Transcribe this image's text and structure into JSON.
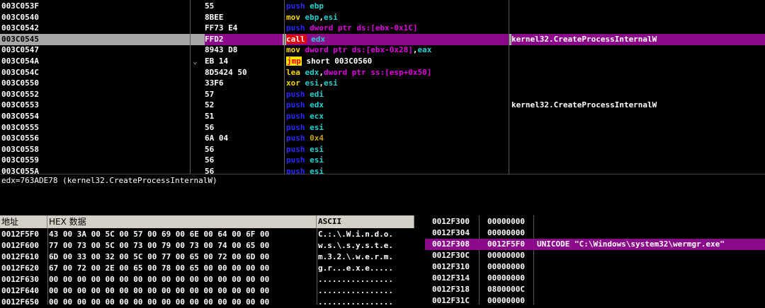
{
  "disasm": {
    "rows": [
      {
        "addr": "003C053F",
        "hex": "55",
        "mn": "push",
        "ops": [
          [
            "reg",
            "ebp"
          ]
        ],
        "cmt": "",
        "jmark": ""
      },
      {
        "addr": "003C0540",
        "hex": "8BEE",
        "mn": "mov",
        "ops": [
          [
            "reg",
            "ebp"
          ],
          [
            "lbl",
            ","
          ],
          [
            "reg",
            "esi"
          ]
        ],
        "cmt": "",
        "jmark": ""
      },
      {
        "addr": "003C0542",
        "hex": "FF73 E4",
        "mn": "push",
        "ops": [
          [
            "mem",
            "dword ptr ds:[ebx-0x1C]"
          ]
        ],
        "cmt": "",
        "jmark": ""
      },
      {
        "addr": "003C0545",
        "hex": "FFD2",
        "mn": "call",
        "ops": [
          [
            "reg",
            "edx"
          ]
        ],
        "cmt": "kernel32.CreateProcessInternalW",
        "jmark": "",
        "selected": true
      },
      {
        "addr": "003C0547",
        "hex": "8943 D8",
        "mn": "mov",
        "ops": [
          [
            "mem",
            "dword ptr ds:[ebx-0x28]"
          ],
          [
            "lbl",
            ","
          ],
          [
            "reg",
            "eax"
          ]
        ],
        "cmt": "",
        "jmark": ""
      },
      {
        "addr": "003C054A",
        "hex": "EB 14",
        "mn": "jmp",
        "ops": [
          [
            "lbl",
            "short 003C0560"
          ]
        ],
        "cmt": "",
        "jmark": "⌄"
      },
      {
        "addr": "003C054C",
        "hex": "8D5424 50",
        "mn": "lea",
        "ops": [
          [
            "reg",
            "edx"
          ],
          [
            "lbl",
            ","
          ],
          [
            "mem",
            "dword ptr ss:[esp+0x50]"
          ]
        ],
        "cmt": "",
        "jmark": ""
      },
      {
        "addr": "003C0550",
        "hex": "33F6",
        "mn": "xor",
        "ops": [
          [
            "reg",
            "esi"
          ],
          [
            "lbl",
            ","
          ],
          [
            "reg",
            "esi"
          ]
        ],
        "cmt": "",
        "jmark": ""
      },
      {
        "addr": "003C0552",
        "hex": "57",
        "mn": "push",
        "ops": [
          [
            "reg",
            "edi"
          ]
        ],
        "cmt": "",
        "jmark": ""
      },
      {
        "addr": "003C0553",
        "hex": "52",
        "mn": "push",
        "ops": [
          [
            "reg",
            "edx"
          ]
        ],
        "cmt": "kernel32.CreateProcessInternalW",
        "jmark": ""
      },
      {
        "addr": "003C0554",
        "hex": "51",
        "mn": "push",
        "ops": [
          [
            "reg",
            "ecx"
          ]
        ],
        "cmt": "",
        "jmark": ""
      },
      {
        "addr": "003C0555",
        "hex": "56",
        "mn": "push",
        "ops": [
          [
            "reg",
            "esi"
          ]
        ],
        "cmt": "",
        "jmark": ""
      },
      {
        "addr": "003C0556",
        "hex": "6A 04",
        "mn": "push",
        "ops": [
          [
            "imm",
            "0x4"
          ]
        ],
        "cmt": "",
        "jmark": ""
      },
      {
        "addr": "003C0558",
        "hex": "56",
        "mn": "push",
        "ops": [
          [
            "reg",
            "esi"
          ]
        ],
        "cmt": "",
        "jmark": ""
      },
      {
        "addr": "003C0559",
        "hex": "56",
        "mn": "push",
        "ops": [
          [
            "reg",
            "esi"
          ]
        ],
        "cmt": "",
        "jmark": ""
      },
      {
        "addr": "003C055A",
        "hex": "56",
        "mn": "push",
        "ops": [
          [
            "reg",
            "esi"
          ]
        ],
        "cmt": "",
        "jmark": ""
      }
    ]
  },
  "info": {
    "text": "edx=763ADE78 (kernel32.CreateProcessInternalW)"
  },
  "dump": {
    "header_addr": "地址",
    "header_hex": "HEX 数据",
    "header_ascii": "ASCII",
    "rows": [
      {
        "addr": "0012F5F0",
        "hex": "43 00 3A 00 5C 00 57 00 69 00 6E 00 64 00 6F 00",
        "ascii": "C.:.\\.W.i.n.d.o."
      },
      {
        "addr": "0012F600",
        "hex": "77 00 73 00 5C 00 73 00 79 00 73 00 74 00 65 00",
        "ascii": "w.s.\\.s.y.s.t.e."
      },
      {
        "addr": "0012F610",
        "hex": "6D 00 33 00 32 00 5C 00 77 00 65 00 72 00 6D 00",
        "ascii": "m.3.2.\\.w.e.r.m."
      },
      {
        "addr": "0012F620",
        "hex": "67 00 72 00 2E 00 65 00 78 00 65 00 00 00 00 00",
        "ascii": "g.r...e.x.e....."
      },
      {
        "addr": "0012F630",
        "hex": "00 00 00 00 00 00 00 00 00 00 00 00 00 00 00 00",
        "ascii": "................"
      },
      {
        "addr": "0012F640",
        "hex": "00 00 00 00 00 00 00 00 00 00 00 00 00 00 00 00",
        "ascii": "................"
      },
      {
        "addr": "0012F650",
        "hex": "00 00 00 00 00 00 00 00 00 00 00 00 00 00 00 00",
        "ascii": "................"
      }
    ]
  },
  "stack": {
    "rows": [
      {
        "addr": "0012F300",
        "val": "00000000",
        "cmt": ""
      },
      {
        "addr": "0012F304",
        "val": "00000000",
        "cmt": ""
      },
      {
        "addr": "0012F308",
        "val": "0012F5F0",
        "cmt": "UNICODE \"C:\\Windows\\system32\\wermgr.exe\"",
        "selected": true
      },
      {
        "addr": "0012F30C",
        "val": "00000000",
        "cmt": ""
      },
      {
        "addr": "0012F310",
        "val": "00000000",
        "cmt": ""
      },
      {
        "addr": "0012F314",
        "val": "00000000",
        "cmt": ""
      },
      {
        "addr": "0012F318",
        "val": "0800000C",
        "cmt": ""
      },
      {
        "addr": "0012F31C",
        "val": "00000000",
        "cmt": ""
      }
    ]
  }
}
